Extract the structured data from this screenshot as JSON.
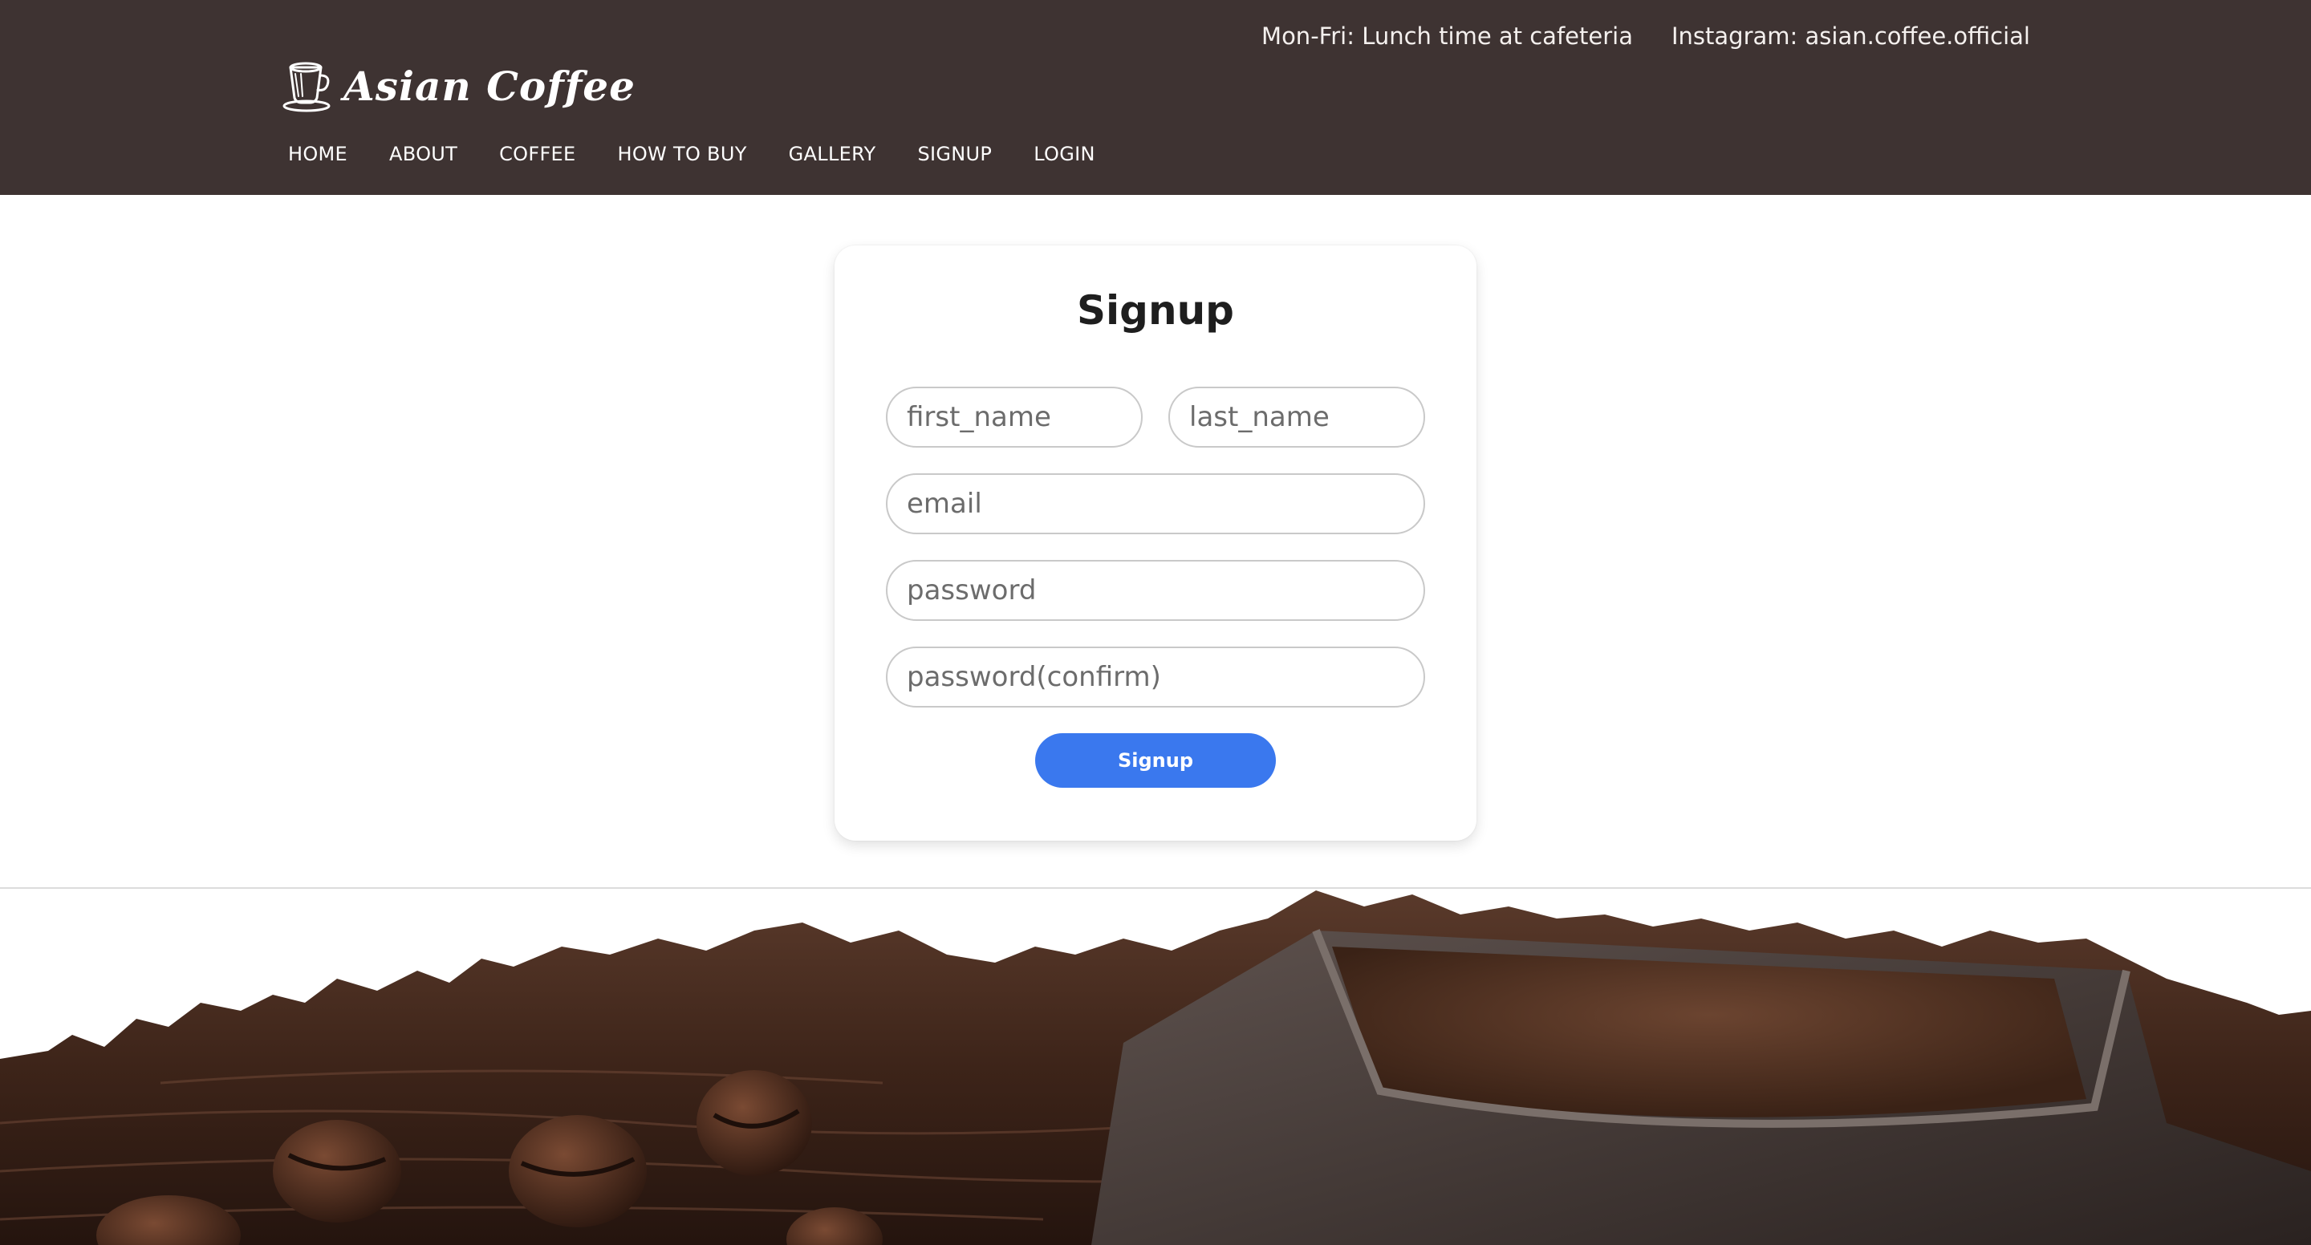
{
  "header": {
    "hours": "Mon-Fri: Lunch time at cafeteria",
    "instagram": "Instagram: asian.coffee.official",
    "logo_text": "Asian Coffee",
    "logo_icon": "coffee-cup-icon",
    "background": "#3e3332"
  },
  "nav": {
    "items": [
      "HOME",
      "ABOUT",
      "COFFEE",
      "HOW TO BUY",
      "GALLERY",
      "SIGNUP",
      "LOGIN"
    ]
  },
  "signup": {
    "title": "Signup",
    "fields": {
      "first_name": {
        "placeholder": "first_name",
        "value": ""
      },
      "last_name": {
        "placeholder": "last_name",
        "value": ""
      },
      "email": {
        "placeholder": "email",
        "value": ""
      },
      "password": {
        "placeholder": "password",
        "value": ""
      },
      "password_confirm": {
        "placeholder": "password(confirm)",
        "value": ""
      }
    },
    "button_label": "Signup",
    "button_color": "#3a78ee"
  },
  "footer_image": {
    "subject": "coffee-beans-and-ground-coffee"
  }
}
